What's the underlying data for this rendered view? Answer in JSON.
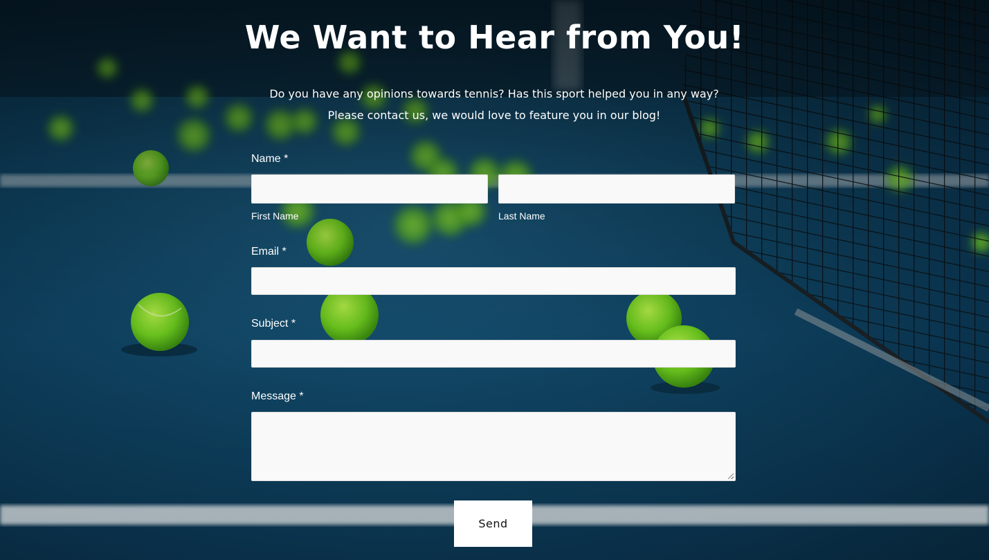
{
  "page": {
    "title": "We Want to Hear from You!",
    "intro_line_1": "Do you have any opinions towards tennis? Has this sport helped you in any way?",
    "intro_line_2": "Please contact us, we would love to feature you in our blog!"
  },
  "form": {
    "name_label": "Name *",
    "first_name_label": "First Name",
    "first_name_value": "",
    "last_name_label": "Last Name",
    "last_name_value": "",
    "email_label": "Email *",
    "email_value": "",
    "subject_label": "Subject *",
    "subject_value": "",
    "message_label": "Message *",
    "message_value": "",
    "send_label": "Send"
  },
  "background": {
    "description_icon": "tennis-court-photo",
    "court_color": "#0f4565",
    "line_color": "#e8eef2",
    "ball_color": "#7ed321"
  }
}
